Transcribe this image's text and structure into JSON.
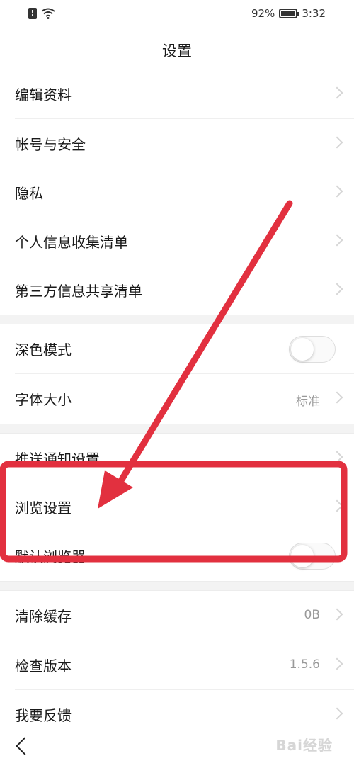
{
  "status_bar": {
    "battery_percent_text": "92%",
    "battery_level": 0.92,
    "time": "3:32",
    "icons": [
      "sim-alert-icon",
      "wifi-icon",
      "battery-icon"
    ]
  },
  "header": {
    "title": "设置"
  },
  "sections": [
    {
      "items": [
        {
          "label": "编辑资料",
          "control": "chevron"
        },
        {
          "label": "帐号与安全",
          "control": "chevron"
        },
        {
          "label": "隐私",
          "control": "chevron"
        },
        {
          "label": "个人信息收集清单",
          "control": "chevron"
        },
        {
          "label": "第三方信息共享清单",
          "control": "chevron"
        }
      ]
    },
    {
      "items": [
        {
          "label": "深色模式",
          "control": "toggle",
          "on": false
        },
        {
          "label": "字体大小",
          "value": "标准",
          "control": "chevron"
        }
      ]
    },
    {
      "items": [
        {
          "label": "推送通知设置",
          "control": "chevron"
        },
        {
          "label": "浏览设置",
          "control": "chevron"
        },
        {
          "label": "默认浏览器",
          "control": "toggle",
          "on": false
        }
      ]
    },
    {
      "items": [
        {
          "label": "清除缓存",
          "value": "0B",
          "control": "chevron"
        },
        {
          "label": "检查版本",
          "value": "1.5.6",
          "control": "chevron"
        },
        {
          "label": "我要反馈",
          "control": "chevron"
        }
      ]
    }
  ],
  "annotation": {
    "color": "#e2303f",
    "highlighted_item": "浏览设置"
  },
  "nav": {
    "back_icon": "chevron-left-icon"
  },
  "watermark": {
    "text": "Bai经验"
  }
}
